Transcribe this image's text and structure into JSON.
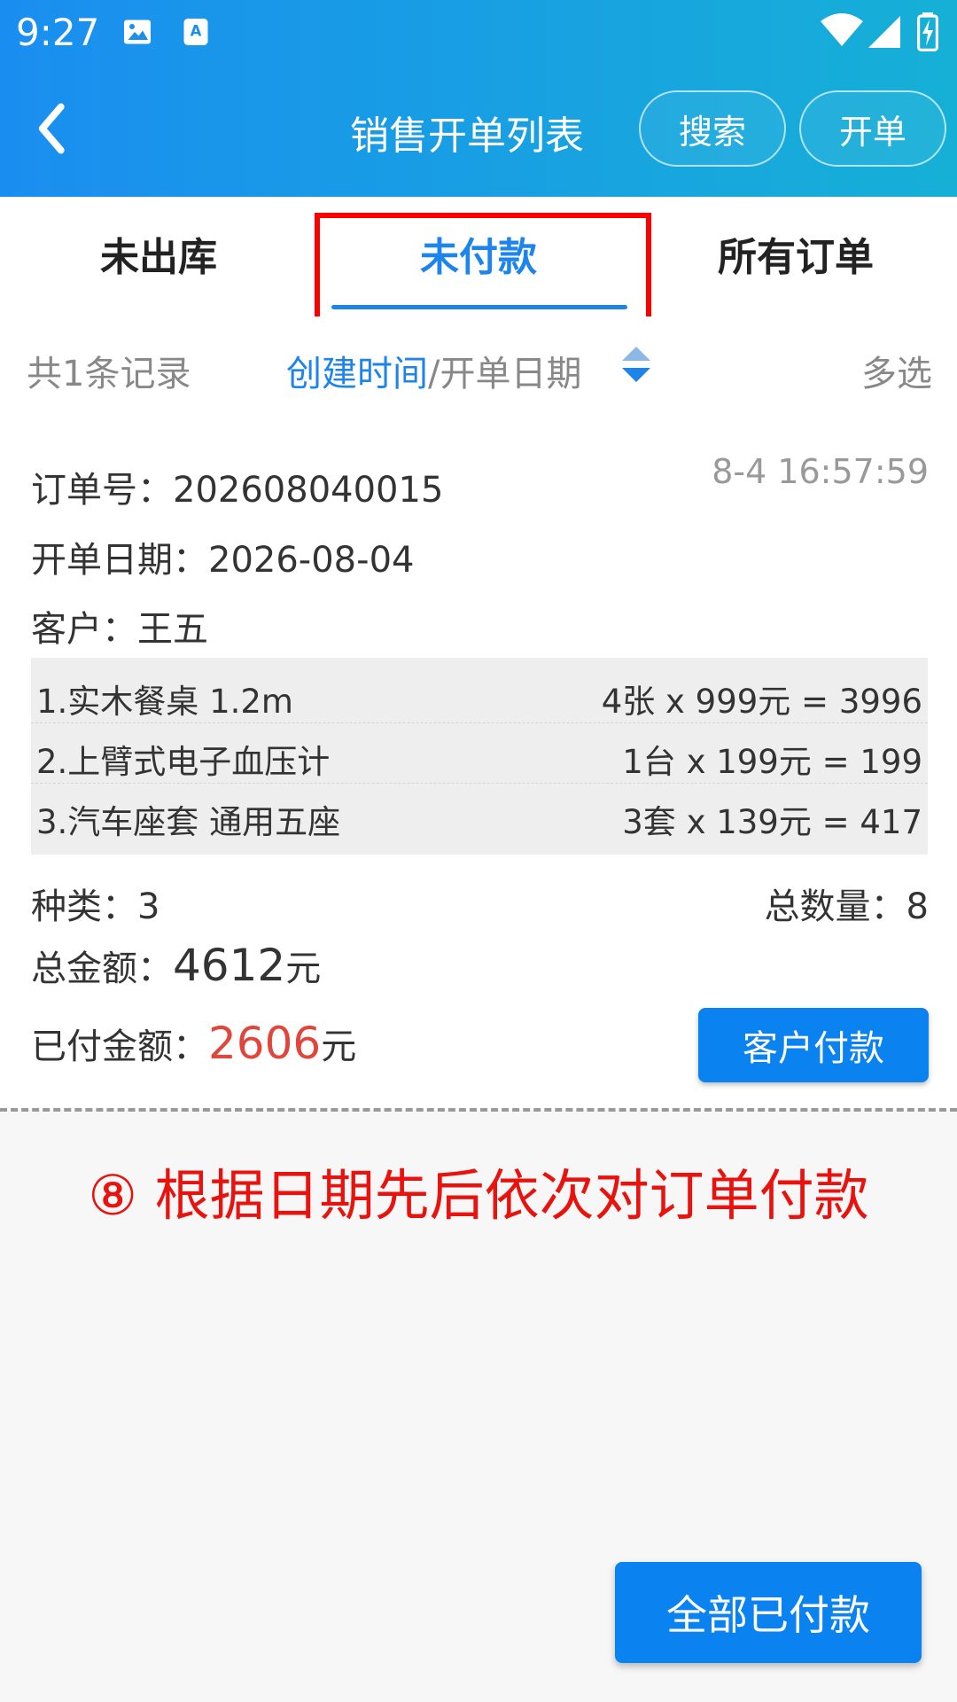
{
  "status_bar": {
    "time": "9:27"
  },
  "header": {
    "title": "销售开单列表",
    "search_label": "搜索",
    "new_order_label": "开单"
  },
  "tabs": [
    {
      "label": "未出库",
      "active": false
    },
    {
      "label": "未付款",
      "active": true
    },
    {
      "label": "所有订单",
      "active": false
    }
  ],
  "filter": {
    "count_text": "共1条记录",
    "sort_active": "创建时间",
    "sort_separator": "/",
    "sort_inactive": "开单日期",
    "multi_select": "多选"
  },
  "order": {
    "order_no_label": "订单号：",
    "order_no": "202608040015",
    "timestamp": "8-4 16:57:59",
    "date_label": "开单日期：",
    "date": "2026-08-04",
    "customer_label": "客户：",
    "customer": "王五",
    "items": [
      {
        "name": "1.实木餐桌 1.2m",
        "calc": "4张 x 999元 = 3996"
      },
      {
        "name": "2.上臂式电子血压计",
        "calc": "1台 x 199元 = 199"
      },
      {
        "name": "3.汽车座套 通用五座",
        "calc": "3套 x 139元 = 417"
      }
    ],
    "kinds_label": "种类：",
    "kinds": "3",
    "total_qty_label": "总数量：",
    "total_qty": "8",
    "total_amount_label": "总金额：",
    "total_amount": "4612",
    "paid_label": "已付金额：",
    "paid_amount": "2606",
    "currency": "元",
    "pay_button": "客户付款"
  },
  "annotation": "⑧ 根据日期先后依次对订单付款",
  "all_paid_button": "全部已付款",
  "colors": {
    "accent": "#1d84ec",
    "paid": "#e0463c",
    "annotation": "#e8130e"
  }
}
